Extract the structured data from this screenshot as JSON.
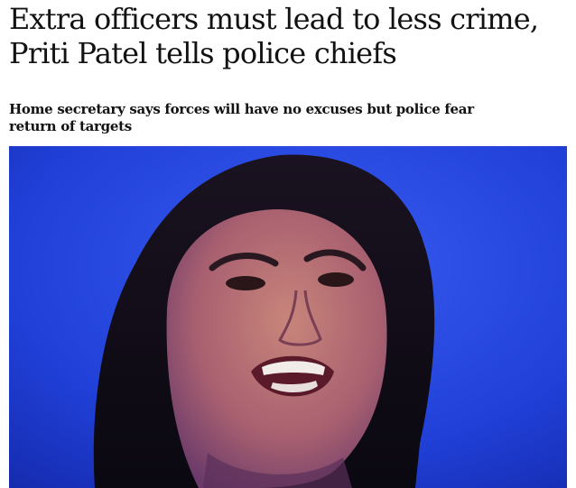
{
  "article": {
    "headline": "Extra officers must lead to less crime, Priti Patel tells police chiefs",
    "standfirst": "Home secretary says forces will have no excuses but police fear return of targets",
    "image": {
      "subject": "photo-of-speaker"
    }
  },
  "colors": {
    "text": "#121212",
    "photo_background": "#1f3fd0"
  }
}
